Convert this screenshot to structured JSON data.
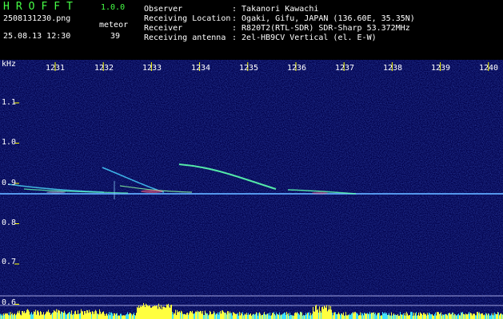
{
  "app": {
    "title": "HROFFT",
    "version": "1.0.0"
  },
  "file": {
    "name": "2508131230.png",
    "datetime": "25.08.13 12:30"
  },
  "meteor": {
    "label": "meteor",
    "count": "39"
  },
  "info": [
    {
      "key": "Observer",
      "value": ": Takanori Kawachi"
    },
    {
      "key": "Receiving Location",
      "value": ": Ogaki, Gifu, JAPAN (136.60E, 35.35N)"
    },
    {
      "key": "Receiver",
      "value": ": R820T2(RTL-SDR) SDR-Sharp 53.372MHz"
    },
    {
      "key": "Receiving antenna",
      "value": ": 2el-HB9CV Vertical (el. E-W)"
    }
  ],
  "axis": {
    "unit": "kHz",
    "time_ticks": [
      "1231",
      "1232",
      "1233",
      "1234",
      "1235",
      "1236",
      "1237",
      "1238",
      "1239",
      "1240"
    ],
    "freq_ticks": [
      "1.1",
      "1.0",
      "0.9",
      "0.8",
      "0.7",
      "0.6"
    ]
  },
  "colors": {
    "background": "#00004a",
    "title": "#46ff46",
    "tick": "#ffff00"
  }
}
